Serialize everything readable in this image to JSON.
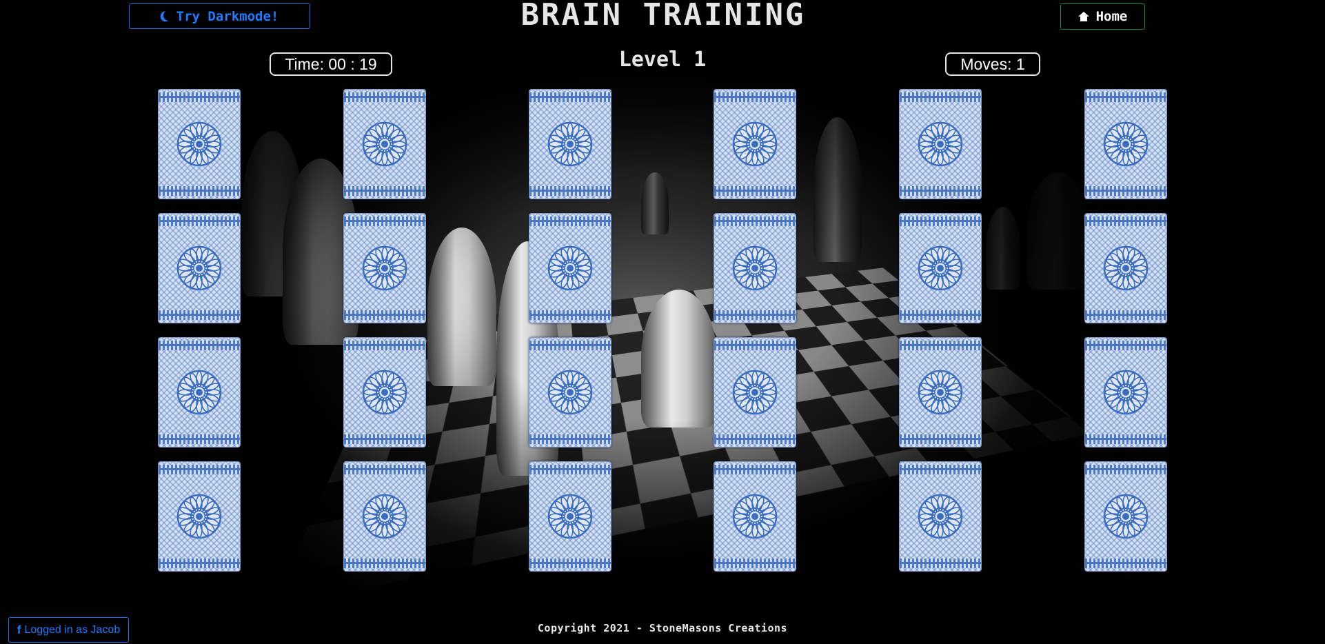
{
  "header": {
    "darkmode_label": "Try Darkmode!",
    "title": "BRAIN TRAINING",
    "home_label": "Home"
  },
  "game": {
    "time_text": "Time: 00 : 19",
    "level_text": "Level 1",
    "moves_text": "Moves: 1",
    "card_count": 24
  },
  "footer": {
    "copyright": "Copyright 2021 - StoneMasons Creations",
    "login_label": "Logged in as Jacob"
  },
  "icons": {
    "darkmode": "moon-icon",
    "home": "home-icon",
    "login": "facebook-icon"
  },
  "colors": {
    "accent_blue": "#1f7bff",
    "home_border": "#1e8c4e",
    "card_blue": "#3a6cc0"
  }
}
